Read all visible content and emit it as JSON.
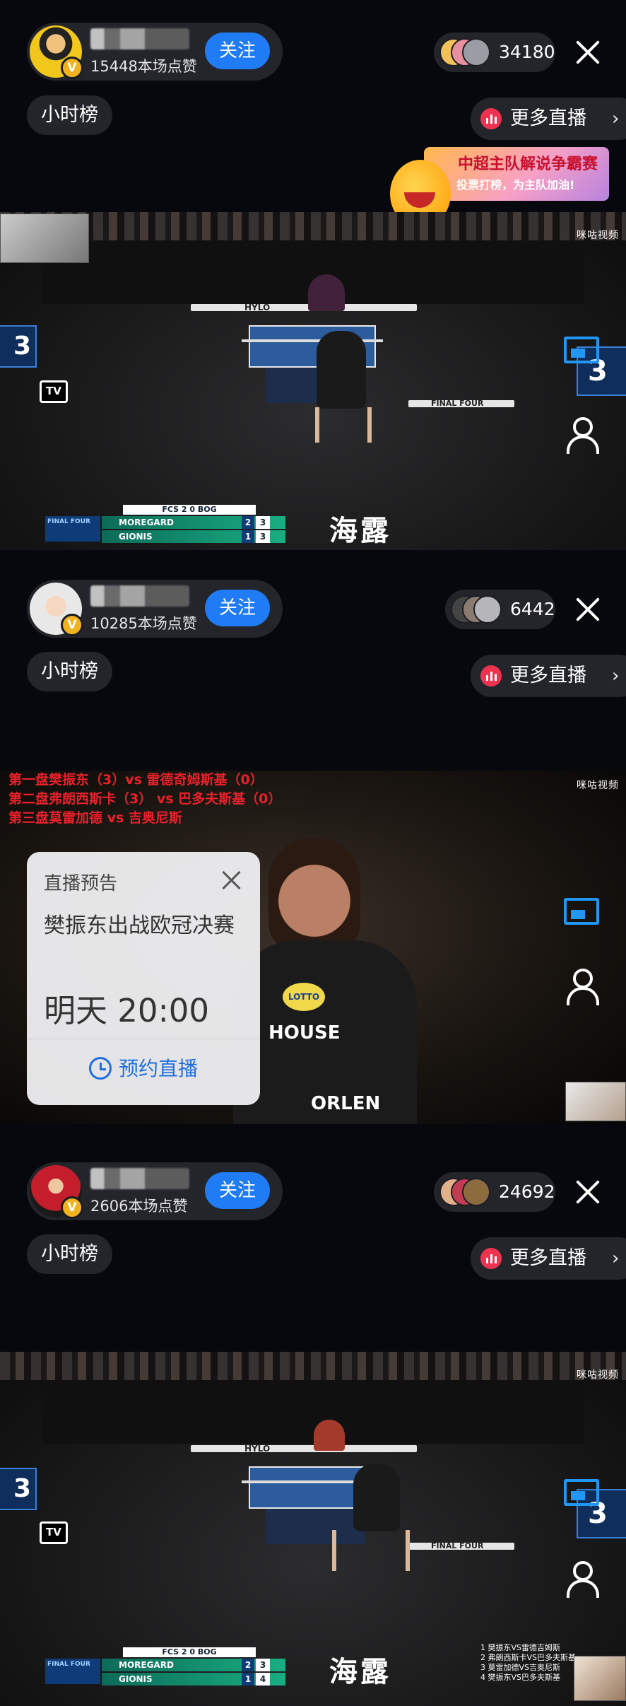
{
  "screens": [
    {
      "host": {
        "likes": "15448本场点赞",
        "follow_label": "关注"
      },
      "viewers": {
        "count": "34180"
      },
      "rank_label": "小时榜",
      "more_live_label": "更多直播",
      "promo": {
        "line1": "中超主队解说争霸赛",
        "line2": "投票打榜，为主队加油!"
      },
      "scoreboard": {
        "teams": [
          "FCS",
          "BOG"
        ],
        "team_score": [
          "2",
          "0"
        ],
        "stage": "FINAL FOUR",
        "players": [
          {
            "name": "MOREGARD",
            "sets": "2",
            "points": "3"
          },
          {
            "name": "GIONIS",
            "sets": "1",
            "points": "3"
          }
        ]
      },
      "side_score": "3",
      "sponsor": "海露",
      "floor_text": "FINAL FOUR",
      "hylo": "HYLO"
    },
    {
      "host": {
        "likes": "10285本场点赞",
        "follow_label": "关注"
      },
      "viewers": {
        "count": "6442"
      },
      "rank_label": "小时榜",
      "more_live_label": "更多直播",
      "captions": [
        "第一盘樊振东（3）vs 雷德奇姆斯基（0）",
        "第二盘弗朗西斯卡（3） vs 巴多夫斯基（0）",
        "第三盘莫雷加德 vs 吉奥尼斯"
      ],
      "preview": {
        "title": "直播预告",
        "event": "樊振东出战欧冠决赛",
        "time": "明天 20:00",
        "book_label": "预约直播"
      },
      "shirt_text": "HOUSE",
      "shirt_text2": "ORLEN",
      "sponsor_badge": "LOTTO"
    },
    {
      "host": {
        "likes": "2606本场点赞",
        "follow_label": "关注"
      },
      "viewers": {
        "count": "24692"
      },
      "rank_label": "小时榜",
      "more_live_label": "更多直播",
      "scoreboard": {
        "teams": [
          "FCS",
          "BOG"
        ],
        "team_score": [
          "2",
          "0"
        ],
        "stage": "FINAL FOUR",
        "players": [
          {
            "name": "MOREGARD",
            "sets": "2",
            "points": "3"
          },
          {
            "name": "GIONIS",
            "sets": "1",
            "points": "4"
          }
        ]
      },
      "side_score": "3",
      "sponsor": "海露",
      "floor_text": "FINAL FOUR",
      "hylo": "HYLO",
      "captions": [
        "1 樊振东VS雷德吉姆斯",
        "2 弗朗西斯卡VS巴多夫斯基",
        "3 莫雷加德VS吉奥尼斯",
        "4 樊振东VS巴多夫斯基"
      ]
    }
  ],
  "brand": {
    "migu": "咪咕",
    "migu_sub": "视频"
  },
  "colors": {
    "follow_blue": "#1f7cf5",
    "pill_bg": "#3c3e46",
    "caption_red": "#e8212b",
    "table_blue": "#2d5c9c"
  }
}
